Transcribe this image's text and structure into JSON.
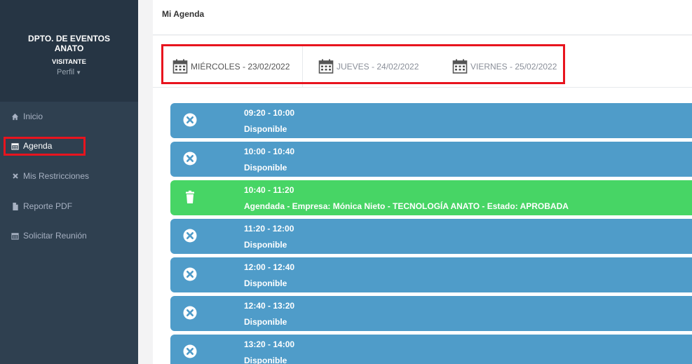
{
  "sidebar": {
    "profile": {
      "org_name": "DPTO. DE EVENTOS ANATO",
      "role": "VISITANTE",
      "perfil_label": "Perfil"
    },
    "items": [
      {
        "label": "Inicio",
        "icon": "home-icon"
      },
      {
        "label": "Agenda",
        "icon": "calendar-icon"
      },
      {
        "label": "Mis Restricciones",
        "icon": "close-icon"
      },
      {
        "label": "Reporte PDF",
        "icon": "file-icon"
      },
      {
        "label": "Solicitar Reunión",
        "icon": "calendar-icon"
      }
    ]
  },
  "header": {
    "title": "Mi Agenda"
  },
  "tabs": [
    {
      "label": "MIÉRCOLES - 23/02/2022",
      "icon": "calendar-icon",
      "active": true
    },
    {
      "label": "JUEVES - 24/02/2022",
      "icon": "calendar-icon",
      "active": false
    },
    {
      "label": "VIERNES - 25/02/2022",
      "icon": "calendar-icon",
      "active": false
    }
  ],
  "slots": [
    {
      "time": "09:20 - 10:00",
      "status": "Disponible",
      "kind": "available",
      "icon": "close-circle-icon"
    },
    {
      "time": "10:00 - 10:40",
      "status": "Disponible",
      "kind": "available",
      "icon": "close-circle-icon"
    },
    {
      "time": "10:40 - 11:20",
      "status": "Agendada - Empresa: Mónica Nieto - TECNOLOGÍA ANATO - Estado: APROBADA",
      "kind": "scheduled",
      "icon": "trash-icon"
    },
    {
      "time": "11:20 - 12:00",
      "status": "Disponible",
      "kind": "available",
      "icon": "close-circle-icon"
    },
    {
      "time": "12:00 - 12:40",
      "status": "Disponible",
      "kind": "available",
      "icon": "close-circle-icon"
    },
    {
      "time": "12:40 - 13:20",
      "status": "Disponible",
      "kind": "available",
      "icon": "close-circle-icon"
    },
    {
      "time": "13:20 - 14:00",
      "status": "Disponible",
      "kind": "available",
      "icon": "close-circle-icon"
    }
  ],
  "colors": {
    "sidebar_bg": "#2f4050",
    "slot_available": "#4f9cc9",
    "slot_scheduled": "#47d565",
    "highlight": "#e8141e"
  }
}
